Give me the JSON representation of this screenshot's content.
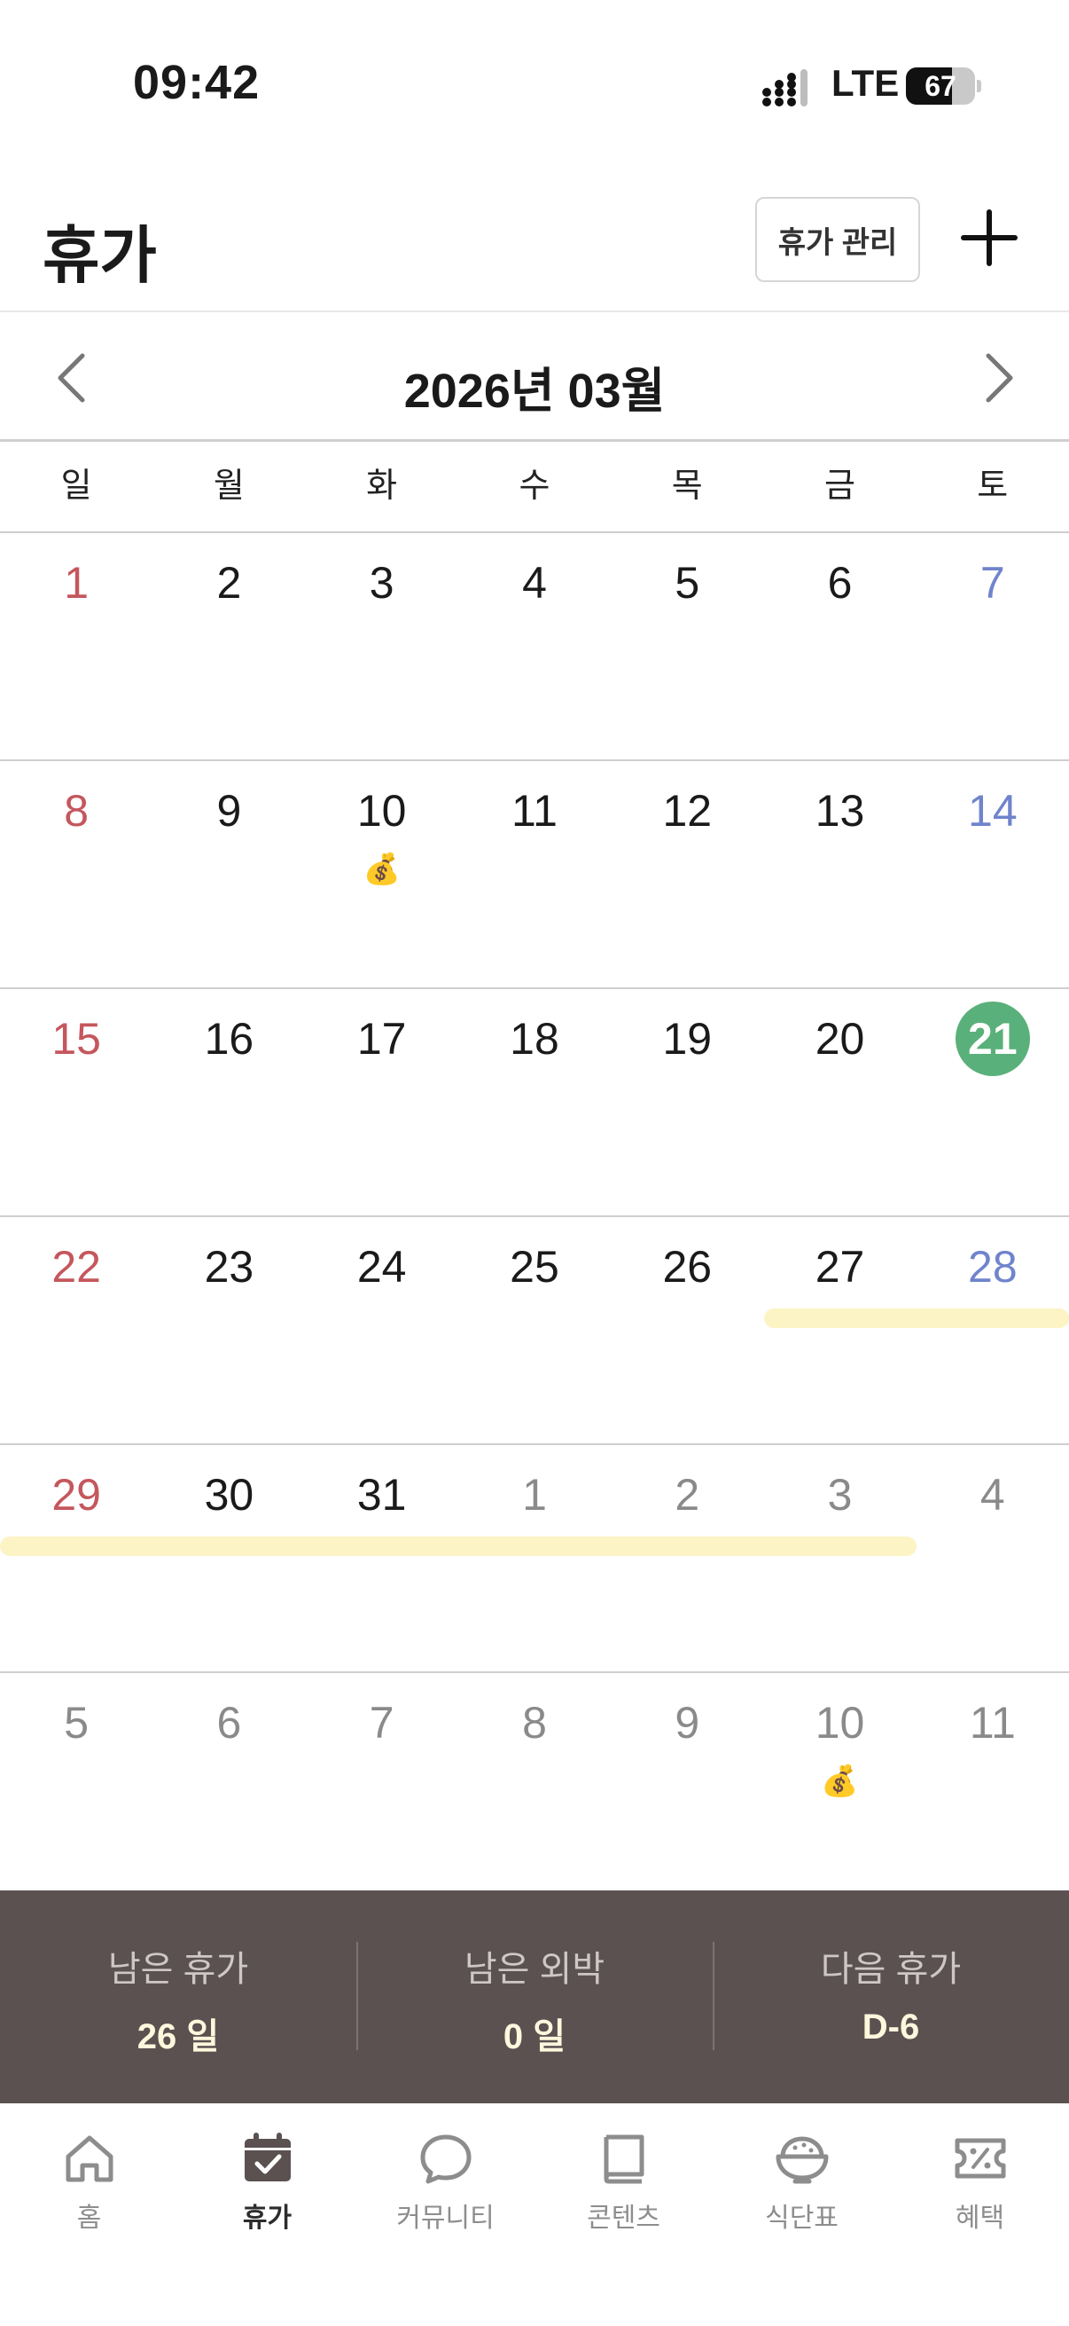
{
  "status_bar": {
    "time": "09:42",
    "network": "LTE",
    "battery": "67"
  },
  "header": {
    "title": "휴가",
    "manage_label": "휴가 관리"
  },
  "month_nav": {
    "title": "2026년 03월"
  },
  "weekdays": [
    "일",
    "월",
    "화",
    "수",
    "목",
    "금",
    "토"
  ],
  "calendar": {
    "today": "21",
    "weeks": [
      [
        "1",
        "2",
        "3",
        "4",
        "5",
        "6",
        "7"
      ],
      [
        "8",
        "9",
        "10",
        "11",
        "12",
        "13",
        "14"
      ],
      [
        "15",
        "16",
        "17",
        "18",
        "19",
        "20",
        "21"
      ],
      [
        "22",
        "23",
        "24",
        "25",
        "26",
        "27",
        "28"
      ],
      [
        "29",
        "30",
        "31",
        "1",
        "2",
        "3",
        "4"
      ],
      [
        "5",
        "6",
        "7",
        "8",
        "9",
        "10",
        "11"
      ]
    ],
    "payday_icon": "money-bag-icon",
    "colors": {
      "sunday": "#c4575d",
      "saturday": "#6f84cc",
      "today": "#5ab07a",
      "vacation": "#fcf4c5"
    }
  },
  "summary": {
    "remaining_leave_label": "남은 휴가",
    "remaining_leave_value": "26 일",
    "remaining_overnight_label": "남은 외박",
    "remaining_overnight_value": "0 일",
    "next_leave_label": "다음 휴가",
    "next_leave_value": "D-6"
  },
  "bottom_nav": [
    {
      "label": "홈",
      "icon": "home-icon"
    },
    {
      "label": "휴가",
      "icon": "calendar-check-icon",
      "active": true
    },
    {
      "label": "커뮤니티",
      "icon": "chat-bubble-icon"
    },
    {
      "label": "콘텐츠",
      "icon": "book-icon"
    },
    {
      "label": "식단표",
      "icon": "rice-bowl-icon"
    },
    {
      "label": "혜택",
      "icon": "coupon-icon"
    }
  ]
}
